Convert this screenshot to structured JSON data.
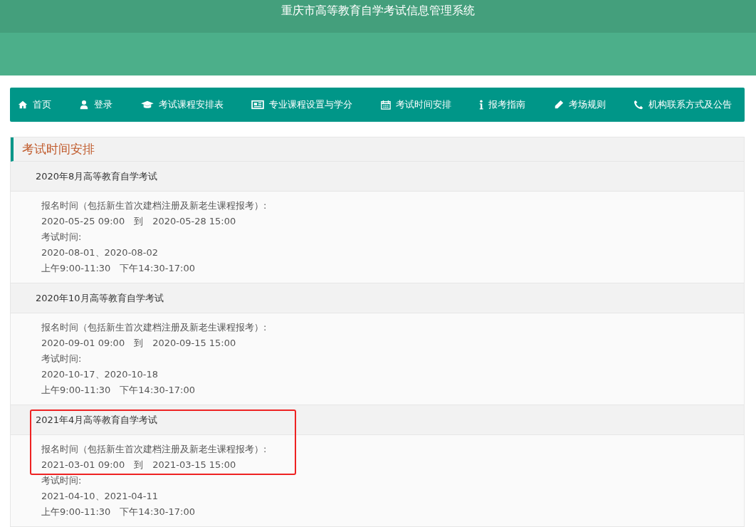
{
  "header": {
    "title": "重庆市高等教育自学考试信息管理系统"
  },
  "nav": [
    {
      "kind": "home",
      "label": "首页"
    },
    {
      "kind": "user",
      "label": "登录"
    },
    {
      "kind": "cap",
      "label": "考试课程安排表"
    },
    {
      "kind": "news",
      "label": "专业课程设置与学分"
    },
    {
      "kind": "calendar",
      "label": "考试时间安排"
    },
    {
      "kind": "info",
      "label": "报考指南"
    },
    {
      "kind": "pencil",
      "label": "考场规则"
    },
    {
      "kind": "phone",
      "label": "机构联系方式及公告"
    }
  ],
  "panel": {
    "heading": "考试时间安排",
    "exams": [
      {
        "title": "2020年8月高等教育自学考试",
        "highlighted": false,
        "lines": [
          "报名时间（包括新生首次建档注册及新老生课程报考）:",
          "2020-05-25 09:00　到　2020-05-28 15:00",
          "考试时间:",
          "2020-08-01、2020-08-02",
          "上午9:00-11:30　下午14:30-17:00"
        ]
      },
      {
        "title": "2020年10月高等教育自学考试",
        "highlighted": false,
        "lines": [
          "报名时间（包括新生首次建档注册及新老生课程报考）:",
          "2020-09-01 09:00　到　2020-09-15 15:00",
          "考试时间:",
          "2020-10-17、2020-10-18",
          "上午9:00-11:30　下午14:30-17:00"
        ]
      },
      {
        "title": "2021年4月高等教育自学考试",
        "highlighted": true,
        "lines": [
          "报名时间（包括新生首次建档注册及新老生课程报考）:",
          "2021-03-01 09:00　到　2021-03-15 15:00",
          "考试时间:",
          "2021-04-10、2021-04-11",
          "上午9:00-11:30　下午14:30-17:00"
        ]
      }
    ]
  }
}
